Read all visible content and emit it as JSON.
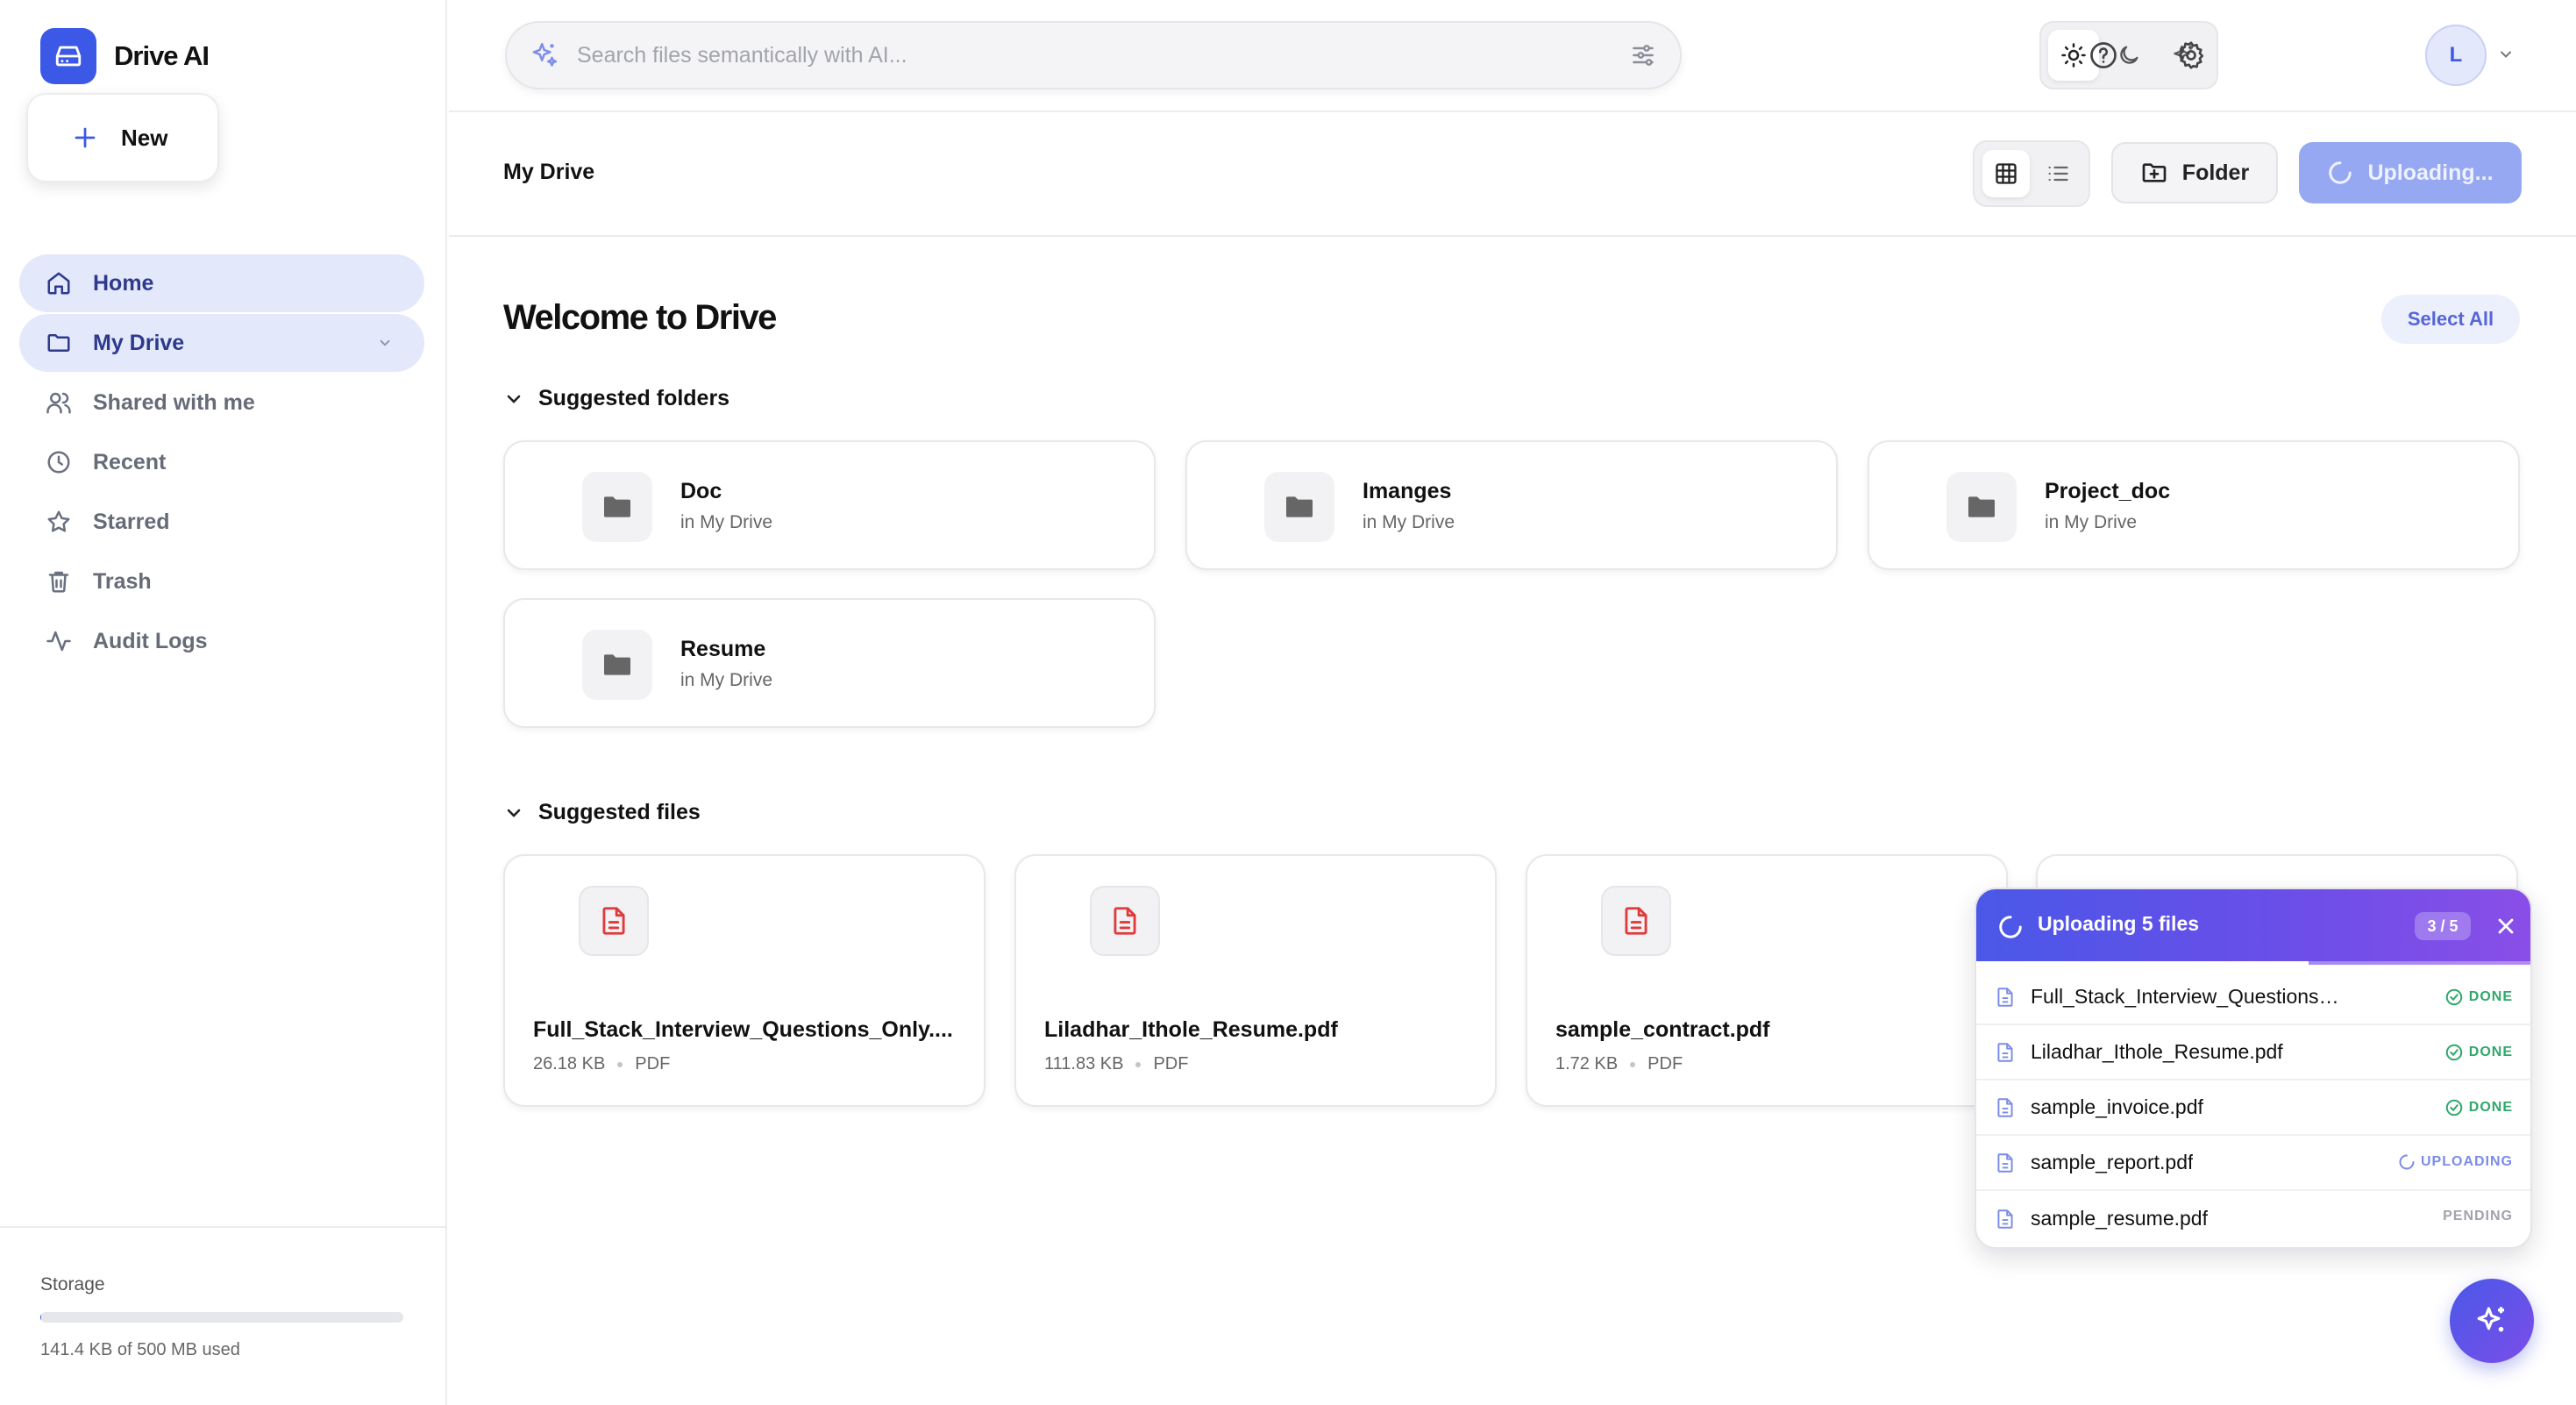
{
  "brand": {
    "name": "Drive AI"
  },
  "new_button": {
    "label": "New"
  },
  "nav": [
    {
      "label": "Home",
      "icon": "home-icon",
      "active": true
    },
    {
      "label": "My Drive",
      "icon": "folder-icon",
      "active": true
    },
    {
      "label": "Shared with me",
      "icon": "users-icon",
      "active": false
    },
    {
      "label": "Recent",
      "icon": "clock-icon",
      "active": false
    },
    {
      "label": "Starred",
      "icon": "star-icon",
      "active": false
    },
    {
      "label": "Trash",
      "icon": "trash-icon",
      "active": false
    },
    {
      "label": "Audit Logs",
      "icon": "activity-icon",
      "active": false
    }
  ],
  "storage": {
    "title": "Storage",
    "used_text": "141.4 KB of 500 MB used",
    "used_fraction": 0.0003
  },
  "search": {
    "placeholder": "Search files semantically with AI...",
    "value": ""
  },
  "user": {
    "initial": "L"
  },
  "breadcrumb": "My Drive",
  "toolbar": {
    "folder_label": "Folder",
    "upload_label": "Uploading..."
  },
  "main": {
    "title": "Welcome to Drive",
    "select_all": "Select All",
    "suggested_folders_label": "Suggested folders",
    "suggested_files_label": "Suggested files",
    "folders": [
      {
        "name": "Doc",
        "location": "in My Drive"
      },
      {
        "name": "Imanges",
        "location": "in My Drive"
      },
      {
        "name": "Project_doc",
        "location": "in My Drive"
      },
      {
        "name": "Resume",
        "location": "in My Drive"
      }
    ],
    "files": [
      {
        "name": "Full_Stack_Interview_Questions_Only....",
        "size": "26.18 KB",
        "type": "PDF"
      },
      {
        "name": "Liladhar_Ithole_Resume.pdf",
        "size": "111.83 KB",
        "type": "PDF"
      },
      {
        "name": "sample_contract.pdf",
        "size": "1.72 KB",
        "type": "PDF"
      }
    ]
  },
  "upload_panel": {
    "title": "Uploading 5 files",
    "count": "3 / 5",
    "progress_fraction": 0.6,
    "items": [
      {
        "name": "Full_Stack_Interview_Questions_...",
        "status": "DONE"
      },
      {
        "name": "Liladhar_Ithole_Resume.pdf",
        "status": "DONE"
      },
      {
        "name": "sample_invoice.pdf",
        "status": "DONE"
      },
      {
        "name": "sample_report.pdf",
        "status": "UPLOADING"
      },
      {
        "name": "sample_resume.pdf",
        "status": "PENDING"
      }
    ]
  },
  "colors": {
    "accent": "#3b59e6",
    "active_nav_bg": "#e4e8fb",
    "pdf_red": "#e03a3a",
    "done_green": "#2fa86b",
    "upload_gradient_start": "#4a58e8",
    "upload_gradient_end": "#8a4ee8"
  }
}
